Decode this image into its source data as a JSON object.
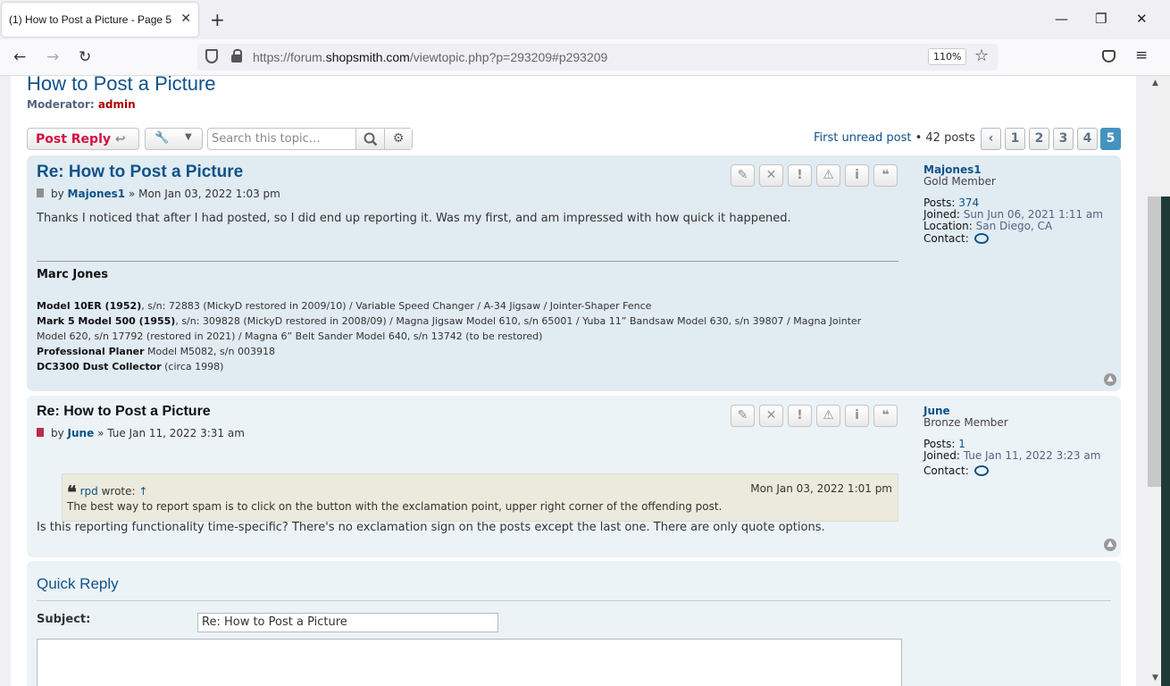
{
  "browser": {
    "tab_title": "(1) How to Post a Picture - Page 5 -",
    "new_tab": "+",
    "url_prefix": "https://forum.",
    "url_domain": "shopsmith.com",
    "url_path": "/viewtopic.php?p=293209#p293209",
    "zoom": "110%"
  },
  "topic": {
    "title": "How to Post a Picture",
    "moderator_label": "Moderator:",
    "moderator_name": "admin"
  },
  "toolbar": {
    "post_reply": "Post Reply",
    "search_placeholder": "Search this topic…",
    "first_unread": "First unread post",
    "post_count": "• 42 posts",
    "pages": [
      "1",
      "2",
      "3",
      "4",
      "5"
    ],
    "current_page": "5"
  },
  "posts": [
    {
      "title": "Re: How to Post a Picture",
      "by": "by",
      "author": "Majones1",
      "date": "» Mon Jan 03, 2022 1:03 pm",
      "body": "Thanks I noticed that after I had posted, so I did end up reporting it. Was my first, and am impressed with how quick it happened.",
      "signature": {
        "name": "Marc Jones",
        "lines": [
          {
            "bold": "Model 10ER (1952)",
            "text": ", s/n: 72883 (MickyD restored in 2009/10) / Variable Speed Changer / A-34 Jigsaw / Jointer-Shaper Fence"
          },
          {
            "bold": "Mark 5 Model 500 (1955)",
            "text": ", s/n: 309828 (MickyD restored in 2008/09) / Magna Jigsaw Model 610, s/n 65001 / Yuba 11” Bandsaw Model 630, s/n 39807 / Magna Jointer"
          },
          {
            "bold": "",
            "text": "Model 620, s/n 17792 (restored in 2021) / Magna 6” Belt Sander Model 640, s/n 13742 (to be restored)"
          },
          {
            "bold": "Professional Planer",
            "text": " Model M5082, s/n 003918"
          },
          {
            "bold": "DC3300 Dust Collector",
            "text": " (circa 1998)"
          }
        ]
      },
      "profile": {
        "name": "Majones1",
        "rank": "Gold Member",
        "posts_label": "Posts:",
        "posts": "374",
        "joined_label": "Joined:",
        "joined": "Sun Jun 06, 2021 1:11 am",
        "location_label": "Location:",
        "location": "San Diego, CA",
        "contact_label": "Contact:"
      }
    },
    {
      "title": "Re: How to Post a Picture",
      "by": "by",
      "author": "June",
      "date": "» Tue Jan 11, 2022 3:31 am",
      "quote": {
        "author": "rpd",
        "wrote": "wrote:",
        "arrow": "↑",
        "date": "Mon Jan 03, 2022 1:01 pm",
        "text": "The best way to report spam is to click on the button with the exclamation point, upper right corner of the offending post."
      },
      "body": "Is this reporting functionality time-specific? There's no exclamation sign on the posts except the last one. There are only quote options.",
      "profile": {
        "name": "June",
        "rank": "Bronze Member",
        "posts_label": "Posts:",
        "posts": "1",
        "joined_label": "Joined:",
        "joined": "Tue Jan 11, 2022 3:23 am",
        "contact_label": "Contact:"
      }
    }
  ],
  "quick_reply": {
    "title": "Quick Reply",
    "subject_label": "Subject:",
    "subject_value": "Re: How to Post a Picture"
  },
  "colors": {
    "link": "#105289",
    "post_reply": "#d31141",
    "active_page": "#4692bf",
    "post_bg_1": "#e1ebf2",
    "post_bg_2": "#ecf3f7"
  }
}
